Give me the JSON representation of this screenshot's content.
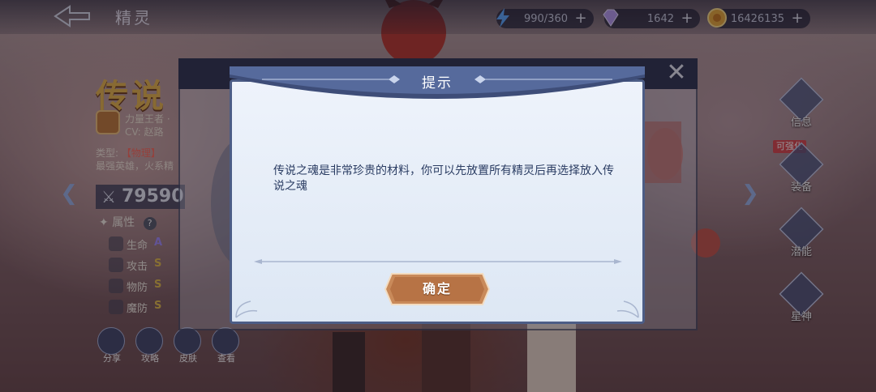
{
  "header": {
    "page_title": "精灵",
    "resources": [
      {
        "icon": "energy-icon",
        "value": "990/360"
      },
      {
        "icon": "diamond-icon",
        "value": "1642"
      },
      {
        "icon": "gold-coin-icon",
        "value": "16426135"
      }
    ]
  },
  "hero": {
    "rarity_text": "传说",
    "title_name": "力量王者 ·",
    "cv": "CV: 赵路",
    "type_label": "类型:",
    "type_value": "【物理】",
    "description": "最强英雄，火系精",
    "power": "79590",
    "attributes_title": "属性",
    "attributes": [
      {
        "label": "生命",
        "grade": "A"
      },
      {
        "label": "攻击",
        "grade": "S"
      },
      {
        "label": "物防",
        "grade": "S"
      },
      {
        "label": "魔防",
        "grade": "S"
      }
    ]
  },
  "bottom_actions": [
    {
      "label": "分享"
    },
    {
      "label": "攻略"
    },
    {
      "label": "皮肤"
    },
    {
      "label": "查看"
    }
  ],
  "side_nav": [
    {
      "label": "信息"
    },
    {
      "label": "装备",
      "badge": "可强化"
    },
    {
      "label": "潜能"
    },
    {
      "label": "星神"
    }
  ],
  "dialog": {
    "title": "提示",
    "message": "传说之魂是非常珍贵的材料，你可以先放置所有精灵后再选择放入传说之魂",
    "confirm_label": "确定"
  },
  "colors": {
    "dialog_border": "#4c5d86",
    "dialog_text": "#2b3d63",
    "confirm_button": "#c98a5a",
    "legend_gold": "#e7b64c"
  }
}
